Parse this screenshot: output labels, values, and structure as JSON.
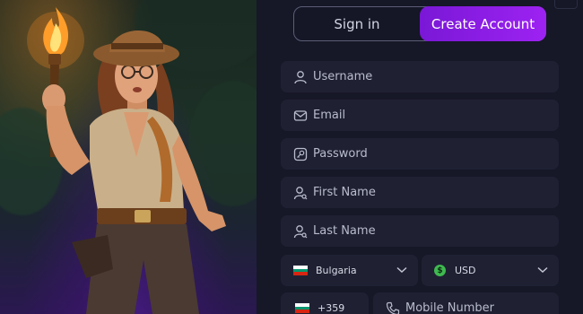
{
  "tabs": {
    "sign_in": "Sign in",
    "create_account": "Create Account",
    "active": "create_account"
  },
  "form": {
    "username": {
      "placeholder": "Username",
      "icon": "user-icon"
    },
    "email": {
      "placeholder": "Email",
      "icon": "envelope-icon"
    },
    "password": {
      "placeholder": "Password",
      "icon": "key-icon"
    },
    "first_name": {
      "placeholder": "First Name",
      "icon": "user-search-icon"
    },
    "last_name": {
      "placeholder": "Last Name",
      "icon": "user-search-icon"
    },
    "country": {
      "value": "Bulgaria",
      "icon": "bulgaria-flag-icon"
    },
    "currency": {
      "value": "USD",
      "icon": "dollar-circle-icon"
    },
    "phone_code": {
      "value": "+359",
      "icon": "bulgaria-flag-icon"
    },
    "mobile": {
      "placeholder": "Mobile Number",
      "icon": "phone-icon"
    }
  },
  "colors": {
    "accent": "#9d22f2",
    "background": "#161727",
    "field": "#1f2133"
  }
}
